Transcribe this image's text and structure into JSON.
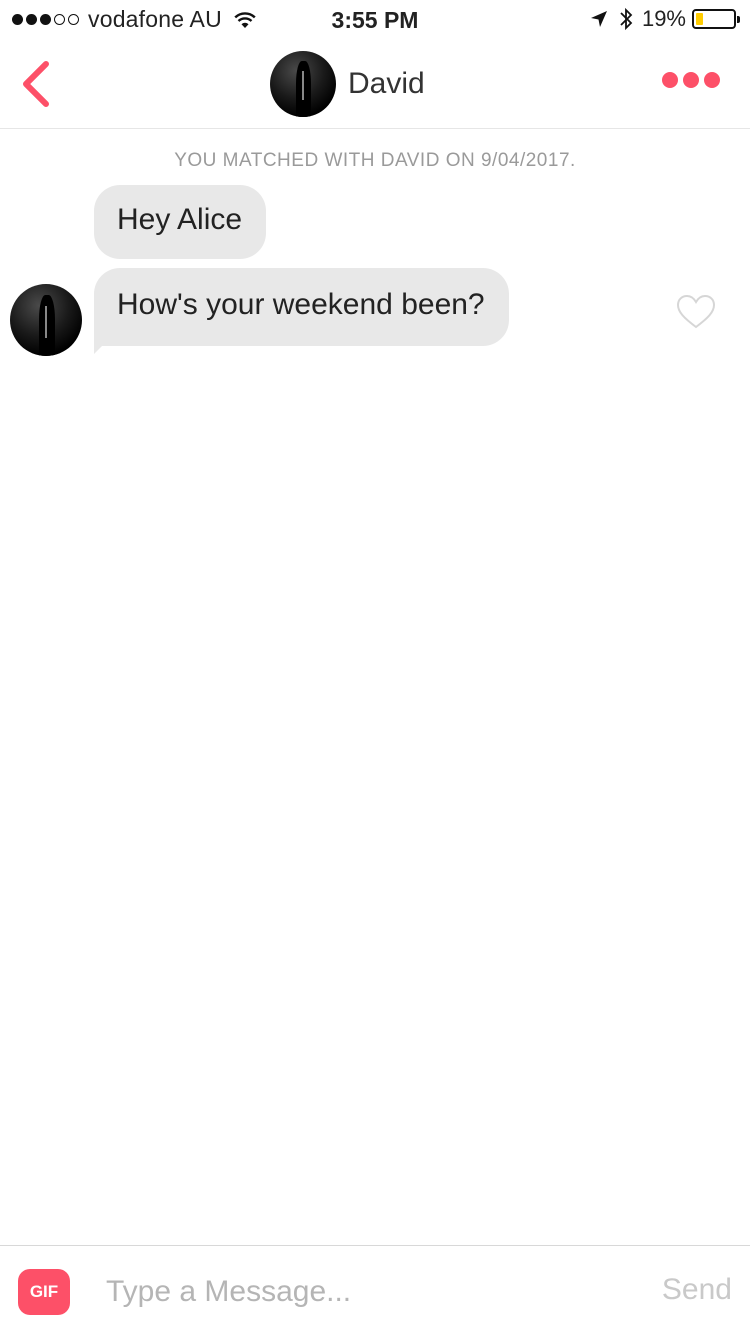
{
  "status_bar": {
    "signal_bars_filled": 3,
    "signal_bars_total": 5,
    "carrier": "vodafone AU",
    "time": "3:55 PM",
    "battery_percent": "19%",
    "battery_level": 0.19,
    "battery_fill_color": "#ffcc00",
    "icons": [
      "wifi-icon",
      "location-arrow-icon",
      "bluetooth-icon",
      "battery-icon"
    ]
  },
  "header": {
    "back_icon": "chevron-left-icon",
    "contact_name": "David",
    "more_icon": "ellipsis-icon",
    "accent_color": "#fd5068"
  },
  "chat": {
    "match_note": "YOU MATCHED WITH DAVID ON 9/04/2017.",
    "messages": [
      {
        "text": "Hey Alice",
        "sender": "David"
      },
      {
        "text": "How's your weekend been?",
        "sender": "David",
        "liked": false
      }
    ],
    "like_icon": "heart-outline-icon"
  },
  "composer": {
    "gif_label": "GIF",
    "placeholder": "Type a Message...",
    "value": "",
    "send_label": "Send"
  }
}
